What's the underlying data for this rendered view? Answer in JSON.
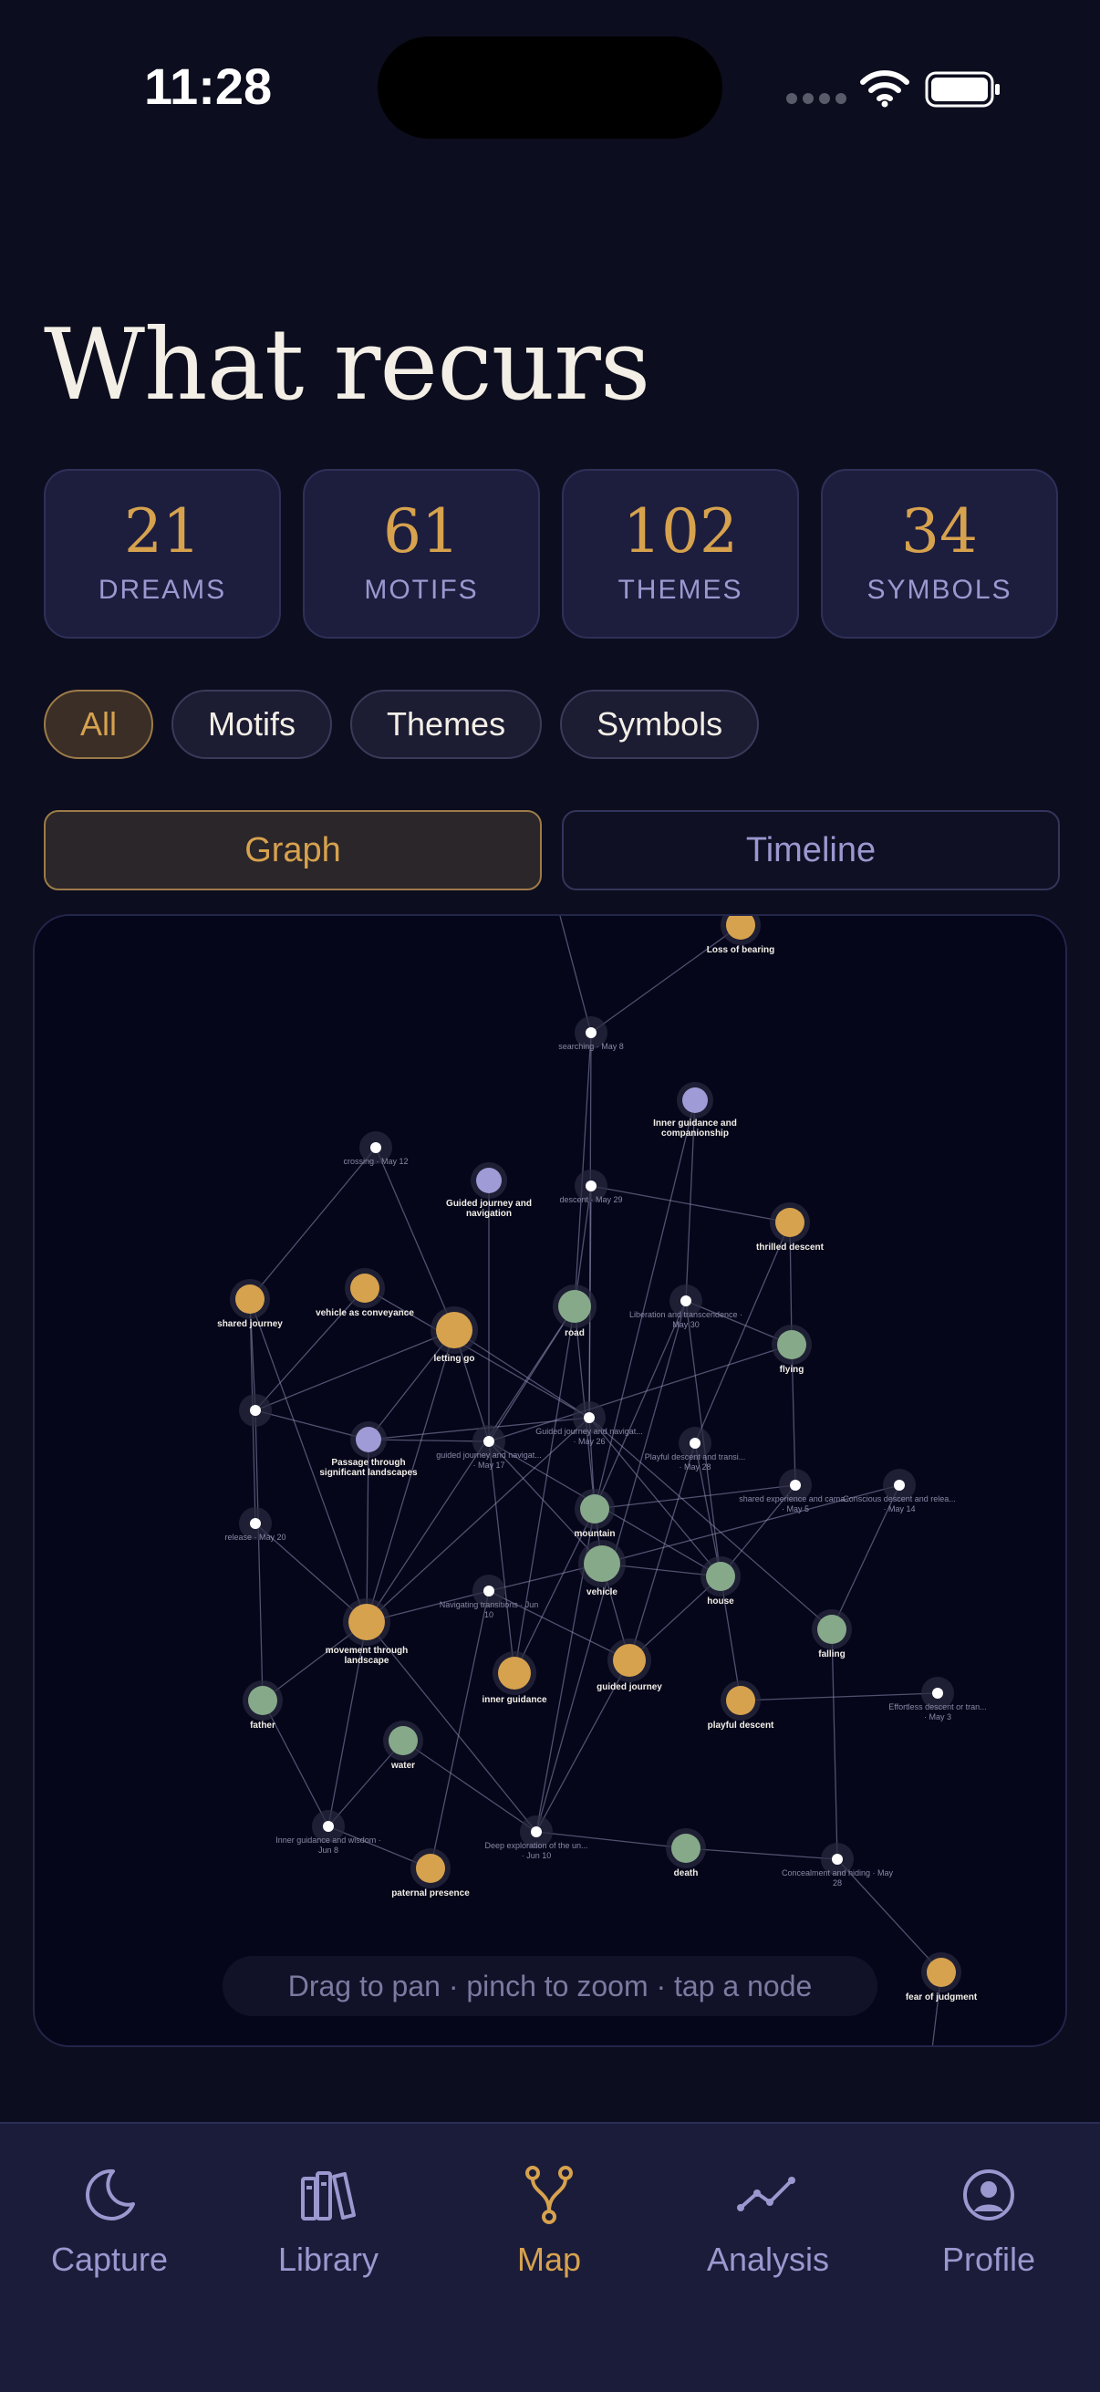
{
  "status": {
    "time": "11:28"
  },
  "title": "What recurs",
  "stats": [
    {
      "value": "21",
      "label": "DREAMS"
    },
    {
      "value": "61",
      "label": "MOTIFS"
    },
    {
      "value": "102",
      "label": "THEMES"
    },
    {
      "value": "34",
      "label": "SYMBOLS"
    }
  ],
  "filters": [
    "All",
    "Motifs",
    "Themes",
    "Symbols"
  ],
  "active_filter": "All",
  "view_toggle": {
    "graph": "Graph",
    "timeline": "Timeline",
    "active": "Graph"
  },
  "graph": {
    "hint": "Drag to pan · pinch to zoom · tap a node",
    "colors": {
      "gold": "#d7a24e",
      "green": "#86a98a",
      "lavender": "#9e9bd6",
      "session": "#ffffff"
    },
    "nodes": [
      {
        "id": "n1",
        "label": "Loss of bearing",
        "kind": "gold"
      },
      {
        "id": "n2",
        "label": "searching · May 8",
        "kind": "session"
      },
      {
        "id": "n3",
        "label": "Inner guidance and companionship",
        "kind": "lavender"
      },
      {
        "id": "n4",
        "label": "crossing · May 12",
        "kind": "session"
      },
      {
        "id": "n5",
        "label": "Guided journey and navigation",
        "kind": "lavender"
      },
      {
        "id": "n6",
        "label": "descent · May 29",
        "kind": "session"
      },
      {
        "id": "n7",
        "label": "thrilled descent",
        "kind": "gold"
      },
      {
        "id": "n8",
        "label": "vehicle as conveyance",
        "kind": "gold"
      },
      {
        "id": "n9",
        "label": "shared journey",
        "kind": "gold"
      },
      {
        "id": "n10",
        "label": "letting go",
        "kind": "gold"
      },
      {
        "id": "n11",
        "label": "road",
        "kind": "green"
      },
      {
        "id": "n12",
        "label": "Liberation and transcendence · May 30",
        "kind": "session"
      },
      {
        "id": "n13",
        "label": "flying",
        "kind": "green"
      },
      {
        "id": "n14",
        "label": "",
        "kind": "session"
      },
      {
        "id": "n15",
        "label": "Passage through significant landscapes",
        "kind": "lavender"
      },
      {
        "id": "n16",
        "label": "guided journey and navigat... · May 17",
        "kind": "session"
      },
      {
        "id": "n17",
        "label": "Guided journey and navigat... · May 26",
        "kind": "session"
      },
      {
        "id": "n18",
        "label": "Playful descent and transi... · May 28",
        "kind": "session"
      },
      {
        "id": "n19",
        "label": "shared experience and cama... · May 5",
        "kind": "session"
      },
      {
        "id": "n20",
        "label": "Conscious descent and relea... · May 14",
        "kind": "session"
      },
      {
        "id": "n21",
        "label": "release · May 20",
        "kind": "session"
      },
      {
        "id": "n22",
        "label": "mountain",
        "kind": "green"
      },
      {
        "id": "n23",
        "label": "vehicle",
        "kind": "green"
      },
      {
        "id": "n24",
        "label": "house",
        "kind": "green"
      },
      {
        "id": "n25",
        "label": "Navigating transitions · Jun 10",
        "kind": "session"
      },
      {
        "id": "n26",
        "label": "movement through landscape",
        "kind": "gold"
      },
      {
        "id": "n27",
        "label": "falling",
        "kind": "green"
      },
      {
        "id": "n28",
        "label": "inner guidance",
        "kind": "gold"
      },
      {
        "id": "n29",
        "label": "guided journey",
        "kind": "gold"
      },
      {
        "id": "n30",
        "label": "father",
        "kind": "green"
      },
      {
        "id": "n31",
        "label": "playful descent",
        "kind": "gold"
      },
      {
        "id": "n32",
        "label": "Effortless descent or tran... · May 3",
        "kind": "session"
      },
      {
        "id": "n33",
        "label": "water",
        "kind": "green"
      },
      {
        "id": "n34",
        "label": "Inner guidance and wisdom · Jun 8",
        "kind": "session"
      },
      {
        "id": "n35",
        "label": "Deep exploration of the un... · Jun 10",
        "kind": "session"
      },
      {
        "id": "n36",
        "label": "death",
        "kind": "green"
      },
      {
        "id": "n37",
        "label": "Concealment and hiding · May 28",
        "kind": "session"
      },
      {
        "id": "n38",
        "label": "paternal presence",
        "kind": "gold"
      },
      {
        "id": "n39",
        "label": "fear of judgment",
        "kind": "gold"
      }
    ],
    "edges": [
      [
        "n1",
        "n2"
      ],
      [
        "n2",
        "n11"
      ],
      [
        "n2",
        "n17"
      ],
      [
        "n3",
        "n12"
      ],
      [
        "n3",
        "n22"
      ],
      [
        "n4",
        "n9"
      ],
      [
        "n4",
        "n10"
      ],
      [
        "n5",
        "n16"
      ],
      [
        "n6",
        "n7"
      ],
      [
        "n6",
        "n11"
      ],
      [
        "n6",
        "n17"
      ],
      [
        "n7",
        "n13"
      ],
      [
        "n7",
        "n18"
      ],
      [
        "n8",
        "n14"
      ],
      [
        "n8",
        "n17"
      ],
      [
        "n9",
        "n14"
      ],
      [
        "n9",
        "n21"
      ],
      [
        "n9",
        "n26"
      ],
      [
        "n10",
        "n14"
      ],
      [
        "n10",
        "n15"
      ],
      [
        "n10",
        "n17"
      ],
      [
        "n10",
        "n16"
      ],
      [
        "n10",
        "n26"
      ],
      [
        "n11",
        "n16"
      ],
      [
        "n11",
        "n22"
      ],
      [
        "n11",
        "n28"
      ],
      [
        "n12",
        "n13"
      ],
      [
        "n12",
        "n24"
      ],
      [
        "n12",
        "n22"
      ],
      [
        "n13",
        "n16"
      ],
      [
        "n13",
        "n19"
      ],
      [
        "n14",
        "n15"
      ],
      [
        "n14",
        "n30"
      ],
      [
        "n15",
        "n16"
      ],
      [
        "n15",
        "n17"
      ],
      [
        "n16",
        "n23"
      ],
      [
        "n16",
        "n24"
      ],
      [
        "n16",
        "n28"
      ],
      [
        "n17",
        "n22"
      ],
      [
        "n17",
        "n24"
      ],
      [
        "n17",
        "n27"
      ],
      [
        "n17",
        "n26"
      ],
      [
        "n18",
        "n24"
      ],
      [
        "n18",
        "n29"
      ],
      [
        "n19",
        "n24"
      ],
      [
        "n19",
        "n22"
      ],
      [
        "n20",
        "n27"
      ],
      [
        "n20",
        "n23"
      ],
      [
        "n21",
        "n26"
      ],
      [
        "n22",
        "n23"
      ],
      [
        "n22",
        "n28"
      ],
      [
        "n22",
        "n35"
      ],
      [
        "n23",
        "n25"
      ],
      [
        "n23",
        "n29"
      ],
      [
        "n23",
        "n24"
      ],
      [
        "n24",
        "n31"
      ],
      [
        "n25",
        "n26"
      ],
      [
        "n25",
        "n29"
      ],
      [
        "n25",
        "n38"
      ],
      [
        "n26",
        "n30"
      ],
      [
        "n26",
        "n34"
      ],
      [
        "n26",
        "n35"
      ],
      [
        "n26",
        "n15"
      ],
      [
        "n27",
        "n37"
      ],
      [
        "n30",
        "n34"
      ],
      [
        "n31",
        "n32"
      ],
      [
        "n33",
        "n34"
      ],
      [
        "n33",
        "n35"
      ],
      [
        "n34",
        "n38"
      ],
      [
        "n35",
        "n36"
      ],
      [
        "n35",
        "n29"
      ],
      [
        "n36",
        "n37"
      ],
      [
        "n37",
        "n39"
      ],
      [
        "n11",
        "n26"
      ],
      [
        "n12",
        "n35"
      ],
      [
        "n29",
        "n24"
      ]
    ]
  },
  "tabs": [
    {
      "label": "Capture",
      "icon": "moon-icon"
    },
    {
      "label": "Library",
      "icon": "library-icon"
    },
    {
      "label": "Map",
      "icon": "map-branch-icon"
    },
    {
      "label": "Analysis",
      "icon": "analysis-icon"
    },
    {
      "label": "Profile",
      "icon": "profile-icon"
    }
  ],
  "active_tab": "Map"
}
